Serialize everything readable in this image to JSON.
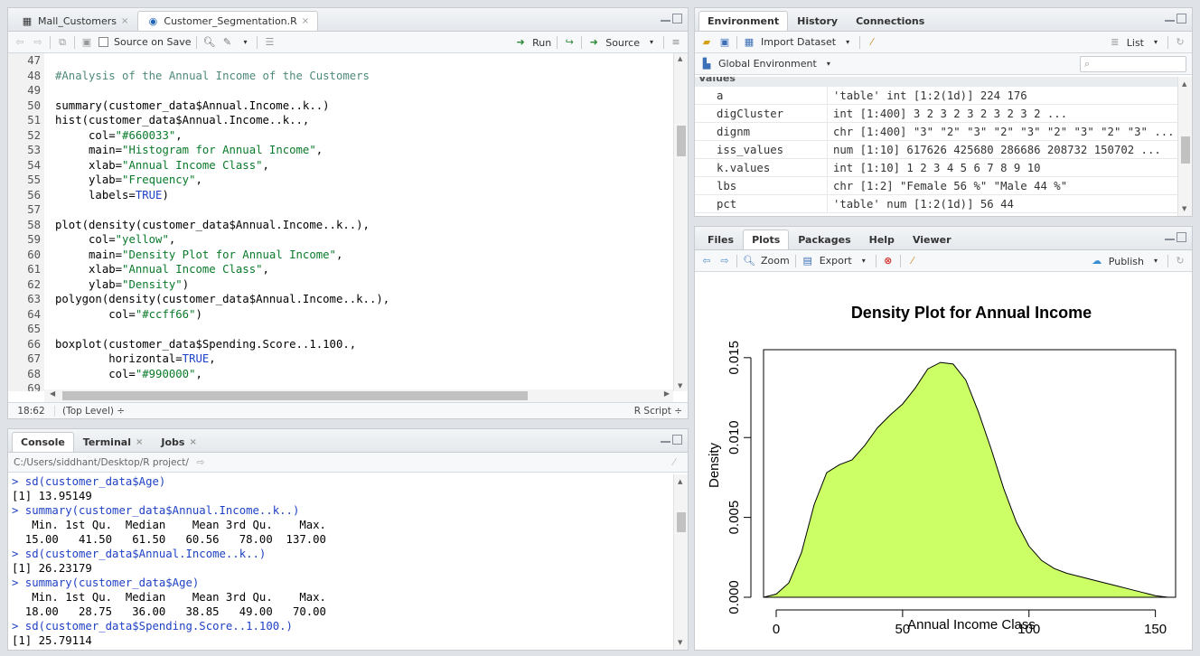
{
  "source_pane": {
    "tabs": [
      {
        "label": "Mall_Customers",
        "close": "×"
      },
      {
        "label": "Customer_Segmentation.R",
        "close": "×"
      }
    ],
    "toolbar": {
      "source_on_save": "Source on Save",
      "run": "Run",
      "source": "Source"
    },
    "lines": [
      {
        "n": "47",
        "html": ""
      },
      {
        "n": "48",
        "html": "<span class='cm'>#Analysis of the Annual Income of the Customers</span>"
      },
      {
        "n": "49",
        "html": ""
      },
      {
        "n": "50",
        "html": "summary(customer_data$Annual.Income..k..)"
      },
      {
        "n": "51",
        "html": "hist(customer_data$Annual.Income..k..,"
      },
      {
        "n": "52",
        "html": "     col=<span class='st'>\"#660033\"</span>,"
      },
      {
        "n": "53",
        "html": "     main=<span class='st'>\"Histogram for Annual Income\"</span>,"
      },
      {
        "n": "54",
        "html": "     xlab=<span class='st'>\"Annual Income Class\"</span>,"
      },
      {
        "n": "55",
        "html": "     ylab=<span class='st'>\"Frequency\"</span>,"
      },
      {
        "n": "56",
        "html": "     labels=<span class='kw'>TRUE</span>)"
      },
      {
        "n": "57",
        "html": ""
      },
      {
        "n": "58",
        "html": "plot(density(customer_data$Annual.Income..k..),"
      },
      {
        "n": "59",
        "html": "     col=<span class='st'>\"yellow\"</span>,"
      },
      {
        "n": "60",
        "html": "     main=<span class='st'>\"Density Plot for Annual Income\"</span>,"
      },
      {
        "n": "61",
        "html": "     xlab=<span class='st'>\"Annual Income Class\"</span>,"
      },
      {
        "n": "62",
        "html": "     ylab=<span class='st'>\"Density\"</span>)"
      },
      {
        "n": "63",
        "html": "polygon(density(customer_data$Annual.Income..k..),"
      },
      {
        "n": "64",
        "html": "        col=<span class='st'>\"#ccff66\"</span>)"
      },
      {
        "n": "65",
        "html": ""
      },
      {
        "n": "66",
        "html": "boxplot(customer_data$Spending.Score..1.100.,"
      },
      {
        "n": "67",
        "html": "        horizontal=<span class='kw'>TRUE</span>,"
      },
      {
        "n": "68",
        "html": "        col=<span class='st'>\"#990000\"</span>,"
      },
      {
        "n": "69",
        "html": ""
      }
    ],
    "status": {
      "position": "18:62",
      "scope": "(Top Level) ÷",
      "filetype": "R Script ÷"
    }
  },
  "console_pane": {
    "tabs": [
      {
        "label": "Console",
        "close": ""
      },
      {
        "label": "Terminal",
        "close": "×"
      },
      {
        "label": "Jobs",
        "close": "×"
      }
    ],
    "path": "C:/Users/siddhant/Desktop/R project/",
    "lines": [
      {
        "t": "> sd(customer_data$Age)",
        "cmd": true
      },
      {
        "t": "[1] 13.95149",
        "cmd": false
      },
      {
        "t": "> summary(customer_data$Annual.Income..k..)",
        "cmd": true
      },
      {
        "t": "   Min. 1st Qu.  Median    Mean 3rd Qu.    Max. ",
        "cmd": false
      },
      {
        "t": "  15.00   41.50   61.50   60.56   78.00  137.00 ",
        "cmd": false
      },
      {
        "t": "> sd(customer_data$Annual.Income..k..)",
        "cmd": true
      },
      {
        "t": "[1] 26.23179",
        "cmd": false
      },
      {
        "t": "> summary(customer_data$Age)",
        "cmd": true
      },
      {
        "t": "   Min. 1st Qu.  Median    Mean 3rd Qu.    Max. ",
        "cmd": false
      },
      {
        "t": "  18.00   28.75   36.00   38.85   49.00   70.00 ",
        "cmd": false
      },
      {
        "t": "> sd(customer_data$Spending.Score..1.100.)",
        "cmd": true
      },
      {
        "t": "[1] 25.79114",
        "cmd": false
      }
    ]
  },
  "env_pane": {
    "tabs": [
      {
        "label": "Environment"
      },
      {
        "label": "History"
      },
      {
        "label": "Connections"
      }
    ],
    "import_dataset": "Import Dataset",
    "list_label": "List",
    "scope": "Global Environment",
    "section": "Values",
    "rows": [
      {
        "name": "a",
        "value": "'table' int [1:2(1d)] 224 176"
      },
      {
        "name": "digCluster",
        "value": "int [1:400] 3 2 3 2 3 2 3 2 3 2 ..."
      },
      {
        "name": "dignm",
        "value": "chr [1:400] \"3\" \"2\" \"3\" \"2\" \"3\" \"2\" \"3\" \"2\" \"3\" ..."
      },
      {
        "name": "iss_values",
        "value": "num [1:10] 617626 425680 286686 208732 150702 ..."
      },
      {
        "name": "k.values",
        "value": "int [1:10] 1 2 3 4 5 6 7 8 9 10"
      },
      {
        "name": "lbs",
        "value": "chr [1:2] \"Female 56 %\" \"Male 44 %\""
      },
      {
        "name": "pct",
        "value": "'table' num [1:2(1d)] 56 44"
      }
    ]
  },
  "plots_pane": {
    "tabs": [
      {
        "label": "Files"
      },
      {
        "label": "Plots"
      },
      {
        "label": "Packages"
      },
      {
        "label": "Help"
      },
      {
        "label": "Viewer"
      }
    ],
    "zoom": "Zoom",
    "export": "Export",
    "publish": "Publish"
  },
  "chart_data": {
    "type": "area",
    "title": "Density Plot for Annual Income",
    "xlabel": "Annual Income Class",
    "ylabel": "Density",
    "xlim": [
      -5,
      158
    ],
    "ylim": [
      0,
      0.0155
    ],
    "xticks": [
      "0",
      "50",
      "100",
      "150"
    ],
    "yticks": [
      "0.000",
      "0.005",
      "0.010",
      "0.015"
    ],
    "fill": "#ccff66",
    "x": [
      -5,
      0,
      5,
      10,
      15,
      20,
      25,
      30,
      35,
      40,
      45,
      50,
      55,
      60,
      65,
      70,
      75,
      80,
      85,
      90,
      95,
      100,
      105,
      110,
      115,
      120,
      125,
      130,
      135,
      140,
      145,
      150,
      155,
      158
    ],
    "y": [
      0.0,
      0.0002,
      0.0009,
      0.0028,
      0.0058,
      0.0078,
      0.0083,
      0.0086,
      0.0095,
      0.0106,
      0.0114,
      0.0121,
      0.0131,
      0.0143,
      0.0147,
      0.0146,
      0.0136,
      0.0116,
      0.0093,
      0.0068,
      0.0047,
      0.0032,
      0.0023,
      0.0018,
      0.0015,
      0.0013,
      0.0011,
      0.0009,
      0.0007,
      0.0005,
      0.0003,
      0.0001,
      0.0,
      0.0
    ]
  }
}
